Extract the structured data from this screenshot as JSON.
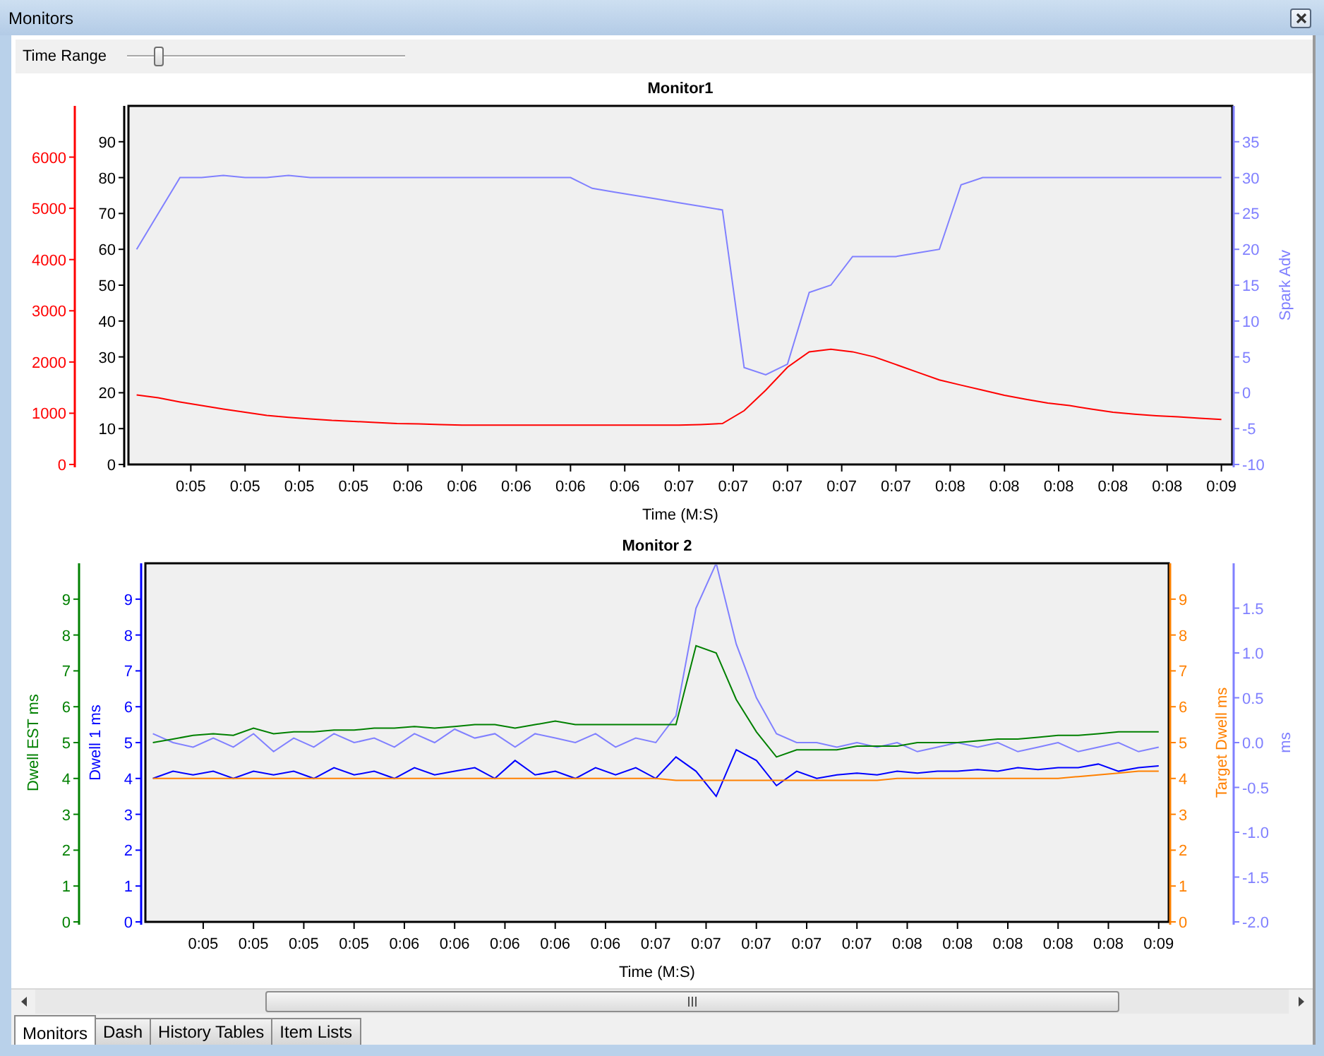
{
  "window": {
    "title": "Monitors"
  },
  "time_range": {
    "label": "Time Range",
    "level": 0.1
  },
  "monitors": [
    {
      "chart_data": {
        "type": "line",
        "title": "Monitor1",
        "xlabel": "Time (M:S)",
        "xlim": [
          4.57,
          8.64
        ],
        "ylim": [
          0,
          100
        ],
        "yticks": [
          0,
          10,
          20,
          30,
          40,
          50,
          60,
          70,
          80,
          90
        ],
        "y2label": "Spark Adv",
        "y2lim": [
          -10,
          40
        ],
        "y2ticks": [
          -10,
          -5,
          0,
          5,
          10,
          15,
          20,
          25,
          30,
          35
        ],
        "xticks": [
          {
            "value": 4.8,
            "label": "0:05"
          },
          {
            "value": 5.0,
            "label": "0:05"
          },
          {
            "value": 5.2,
            "label": "0:05"
          },
          {
            "value": 5.4,
            "label": "0:05"
          },
          {
            "value": 5.6,
            "label": "0:06"
          },
          {
            "value": 5.8,
            "label": "0:06"
          },
          {
            "value": 6.0,
            "label": "0:06"
          },
          {
            "value": 6.2,
            "label": "0:06"
          },
          {
            "value": 6.4,
            "label": "0:06"
          },
          {
            "value": 6.6,
            "label": "0:07"
          },
          {
            "value": 6.8,
            "label": "0:07"
          },
          {
            "value": 7.0,
            "label": "0:07"
          },
          {
            "value": 7.2,
            "label": "0:07"
          },
          {
            "value": 7.4,
            "label": "0:07"
          },
          {
            "value": 7.6,
            "label": "0:08"
          },
          {
            "value": 7.8,
            "label": "0:08"
          },
          {
            "value": 8.0,
            "label": "0:08"
          },
          {
            "value": 8.2,
            "label": "0:08"
          },
          {
            "value": 8.4,
            "label": "0:08"
          },
          {
            "value": 8.6,
            "label": "0:09"
          }
        ],
        "x": [
          4.6,
          4.68,
          4.76,
          4.84,
          4.92,
          5,
          5.08,
          5.16,
          5.24,
          5.32,
          5.4,
          5.48,
          5.56,
          5.64,
          5.72,
          5.8,
          5.88,
          5.96,
          6.04,
          6.12,
          6.2,
          6.28,
          6.36,
          6.44,
          6.52,
          6.6,
          6.68,
          6.76,
          6.84,
          6.92,
          7,
          7.08,
          7.16,
          7.24,
          7.32,
          7.4,
          7.48,
          7.56,
          7.64,
          7.72,
          7.8,
          7.88,
          7.96,
          8.04,
          8.12,
          8.2,
          8.28,
          8.36,
          8.44,
          8.52,
          8.6
        ],
        "series": [
          {
            "color": "#8080ff",
            "axis": "y2",
            "values": [
              20,
              25,
              30,
              30,
              30.3,
              30,
              30,
              30.3,
              30,
              30,
              30,
              30,
              30,
              30,
              30,
              30,
              30,
              30,
              30,
              30,
              30,
              28.5,
              28,
              27.5,
              27,
              26.5,
              26,
              25.5,
              3.5,
              2.5,
              4,
              14,
              15,
              19,
              19,
              19,
              19.5,
              20,
              29,
              30,
              30,
              30,
              30,
              30,
              30,
              30,
              30,
              30,
              30,
              30,
              30
            ]
          }
        ]
      },
      "overlay": {
        "chart_data": {
          "type": "line",
          "xlim": [
            4.57,
            8.64
          ],
          "ylim": [
            0,
            7000
          ],
          "yticks": [
            0,
            1000,
            2000,
            3000,
            4000,
            5000,
            6000
          ],
          "x": [
            4.6,
            4.68,
            4.76,
            4.84,
            4.92,
            5,
            5.08,
            5.16,
            5.24,
            5.32,
            5.4,
            5.48,
            5.56,
            5.64,
            5.72,
            5.8,
            5.88,
            5.96,
            6.04,
            6.12,
            6.2,
            6.28,
            6.36,
            6.44,
            6.52,
            6.6,
            6.68,
            6.76,
            6.84,
            6.92,
            7,
            7.08,
            7.16,
            7.24,
            7.32,
            7.4,
            7.48,
            7.56,
            7.64,
            7.72,
            7.8,
            7.88,
            7.96,
            8.04,
            8.12,
            8.2,
            8.28,
            8.36,
            8.44,
            8.52,
            8.6
          ],
          "series": [
            {
              "color": "#ff0000",
              "values": [
                1360,
                1300,
                1220,
                1150,
                1080,
                1020,
                960,
                920,
                890,
                860,
                840,
                820,
                800,
                790,
                780,
                770,
                770,
                770,
                770,
                770,
                770,
                770,
                770,
                770,
                770,
                770,
                780,
                800,
                1050,
                1450,
                1900,
                2200,
                2250,
                2200,
                2100,
                1950,
                1800,
                1650,
                1550,
                1450,
                1350,
                1270,
                1200,
                1150,
                1080,
                1020,
                980,
                950,
                930,
                900,
                880
              ]
            }
          ]
        }
      }
    },
    {
      "chart_data": {
        "type": "line",
        "title": "Monitor 2",
        "xlabel": "Time (M:S)",
        "xlim": [
          4.57,
          8.64
        ],
        "ylabel": "Dwell 1 ms",
        "ylim": [
          0,
          10
        ],
        "yticks": [
          0,
          1,
          2,
          3,
          4,
          5,
          6,
          7,
          8,
          9
        ],
        "y2label": "Target Dwell ms",
        "y2lim": [
          0,
          10
        ],
        "y2ticks": [
          0,
          1,
          2,
          3,
          4,
          5,
          6,
          7,
          8,
          9
        ],
        "y3label": "ms",
        "y3lim": [
          -2,
          2
        ],
        "y3ticks": [
          {
            "value": -2,
            "label": "-2.0"
          },
          {
            "value": -1.5,
            "label": "-1.5"
          },
          {
            "value": -1,
            "label": "-1.0"
          },
          {
            "value": -0.5,
            "label": "-0.5"
          },
          {
            "value": 0,
            "label": "0.0"
          },
          {
            "value": 0.5,
            "label": "0.5"
          },
          {
            "value": 1,
            "label": "1.0"
          },
          {
            "value": 1.5,
            "label": "1.5"
          }
        ],
        "xticks": [
          {
            "value": 4.8,
            "label": "0:05"
          },
          {
            "value": 5.0,
            "label": "0:05"
          },
          {
            "value": 5.2,
            "label": "0:05"
          },
          {
            "value": 5.4,
            "label": "0:05"
          },
          {
            "value": 5.6,
            "label": "0:06"
          },
          {
            "value": 5.8,
            "label": "0:06"
          },
          {
            "value": 6.0,
            "label": "0:06"
          },
          {
            "value": 6.2,
            "label": "0:06"
          },
          {
            "value": 6.4,
            "label": "0:06"
          },
          {
            "value": 6.6,
            "label": "0:07"
          },
          {
            "value": 6.8,
            "label": "0:07"
          },
          {
            "value": 7.0,
            "label": "0:07"
          },
          {
            "value": 7.2,
            "label": "0:07"
          },
          {
            "value": 7.4,
            "label": "0:07"
          },
          {
            "value": 7.6,
            "label": "0:08"
          },
          {
            "value": 7.8,
            "label": "0:08"
          },
          {
            "value": 8.0,
            "label": "0:08"
          },
          {
            "value": 8.2,
            "label": "0:08"
          },
          {
            "value": 8.4,
            "label": "0:08"
          },
          {
            "value": 8.6,
            "label": "0:09"
          }
        ],
        "x": [
          4.6,
          4.68,
          4.76,
          4.84,
          4.92,
          5,
          5.08,
          5.16,
          5.24,
          5.32,
          5.4,
          5.48,
          5.56,
          5.64,
          5.72,
          5.8,
          5.88,
          5.96,
          6.04,
          6.12,
          6.2,
          6.28,
          6.36,
          6.44,
          6.52,
          6.6,
          6.68,
          6.76,
          6.84,
          6.92,
          7,
          7.08,
          7.16,
          7.24,
          7.32,
          7.4,
          7.48,
          7.56,
          7.64,
          7.72,
          7.8,
          7.88,
          7.96,
          8.04,
          8.12,
          8.2,
          8.28,
          8.36,
          8.44,
          8.52,
          8.6
        ],
        "series": [
          {
            "color": "#8080ff",
            "axis": "y3",
            "values": [
              0.1,
              0.0,
              -0.05,
              0.05,
              -0.05,
              0.1,
              -0.1,
              0.05,
              -0.05,
              0.1,
              0.0,
              0.05,
              -0.05,
              0.1,
              0.0,
              0.15,
              0.05,
              0.1,
              -0.05,
              0.1,
              0.05,
              0.0,
              0.1,
              -0.05,
              0.05,
              0.0,
              0.3,
              1.5,
              2.0,
              1.1,
              0.5,
              0.1,
              0.0,
              0.0,
              -0.05,
              0.0,
              -0.05,
              0.0,
              -0.1,
              -0.05,
              0.0,
              -0.05,
              0.0,
              -0.1,
              -0.05,
              0.0,
              -0.1,
              -0.05,
              0.0,
              -0.1,
              -0.05
            ]
          },
          {
            "color": "#0000ff",
            "values": [
              4.0,
              4.2,
              4.1,
              4.2,
              4.0,
              4.2,
              4.1,
              4.2,
              4.0,
              4.3,
              4.1,
              4.2,
              4.0,
              4.3,
              4.1,
              4.2,
              4.3,
              4.0,
              4.5,
              4.1,
              4.2,
              4.0,
              4.3,
              4.1,
              4.3,
              4.0,
              4.6,
              4.2,
              3.5,
              4.8,
              4.5,
              3.8,
              4.2,
              4.0,
              4.1,
              4.15,
              4.1,
              4.2,
              4.15,
              4.2,
              4.2,
              4.25,
              4.2,
              4.3,
              4.25,
              4.3,
              4.3,
              4.4,
              4.2,
              4.3,
              4.35
            ]
          },
          {
            "color": "#ff8000",
            "axis": "y2",
            "values": [
              4,
              4,
              4,
              4,
              4,
              4,
              4,
              4,
              4,
              4,
              4,
              4,
              4,
              4,
              4,
              4,
              4,
              4,
              4,
              4,
              4,
              4,
              4,
              4,
              4,
              4,
              3.95,
              3.95,
              3.95,
              3.95,
              3.95,
              3.95,
              3.95,
              3.95,
              3.95,
              3.95,
              3.95,
              4,
              4,
              4,
              4,
              4,
              4,
              4,
              4,
              4,
              4.05,
              4.1,
              4.15,
              4.2,
              4.2
            ]
          }
        ]
      },
      "overlay": {
        "chart_data": {
          "type": "line",
          "ylabel": "Dwell EST ms",
          "xlim": [
            4.57,
            8.64
          ],
          "ylim": [
            0,
            10
          ],
          "yticks": [
            0,
            1,
            2,
            3,
            4,
            5,
            6,
            7,
            8,
            9
          ],
          "x": [
            4.6,
            4.68,
            4.76,
            4.84,
            4.92,
            5,
            5.08,
            5.16,
            5.24,
            5.32,
            5.4,
            5.48,
            5.56,
            5.64,
            5.72,
            5.8,
            5.88,
            5.96,
            6.04,
            6.12,
            6.2,
            6.28,
            6.36,
            6.44,
            6.52,
            6.6,
            6.68,
            6.76,
            6.84,
            6.92,
            7,
            7.08,
            7.16,
            7.24,
            7.32,
            7.4,
            7.48,
            7.56,
            7.64,
            7.72,
            7.8,
            7.88,
            7.96,
            8.04,
            8.12,
            8.2,
            8.28,
            8.36,
            8.44,
            8.52,
            8.6
          ],
          "series": [
            {
              "color": "#008000",
              "values": [
                5.0,
                5.1,
                5.2,
                5.25,
                5.2,
                5.4,
                5.25,
                5.3,
                5.3,
                5.35,
                5.35,
                5.4,
                5.4,
                5.45,
                5.4,
                5.45,
                5.5,
                5.5,
                5.4,
                5.5,
                5.6,
                5.5,
                5.5,
                5.5,
                5.5,
                5.5,
                5.5,
                7.7,
                7.5,
                6.2,
                5.3,
                4.6,
                4.8,
                4.8,
                4.8,
                4.9,
                4.9,
                4.9,
                5.0,
                5.0,
                5.0,
                5.05,
                5.1,
                5.1,
                5.15,
                5.2,
                5.2,
                5.25,
                5.3,
                5.3,
                5.3
              ]
            }
          ]
        }
      }
    }
  ],
  "tabs": [
    {
      "label": "Monitors",
      "selected": true
    },
    {
      "label": "Dash",
      "selected": false
    },
    {
      "label": "History Tables",
      "selected": false
    },
    {
      "label": "Item Lists",
      "selected": false
    }
  ]
}
